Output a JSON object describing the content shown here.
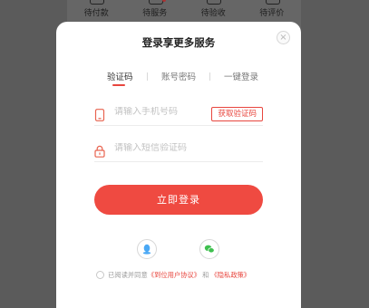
{
  "background": {
    "tabs": [
      {
        "label": "待付款",
        "icon": "wallet-icon",
        "badge": false
      },
      {
        "label": "待服务",
        "icon": "service-icon",
        "badge": true
      },
      {
        "label": "待验收",
        "icon": "inspect-icon",
        "badge": false
      },
      {
        "label": "待评价",
        "icon": "review-icon",
        "badge": false
      }
    ]
  },
  "modal": {
    "title": "登录享更多服务",
    "close_icon": "×",
    "tabs": [
      {
        "label": "验证码",
        "active": true
      },
      {
        "label": "账号密码",
        "active": false
      },
      {
        "label": "一键登录",
        "active": false
      }
    ],
    "phone": {
      "placeholder": "请输入手机号码",
      "value": "",
      "icon": "phone-icon"
    },
    "code_button": "获取验证码",
    "sms": {
      "placeholder": "请输入短信验证码",
      "value": "",
      "icon": "lock-icon"
    },
    "login_button": "立即登录",
    "social": [
      {
        "name": "qq",
        "icon": "qq-icon",
        "color": "#4aa8f5"
      },
      {
        "name": "wechat",
        "icon": "wechat-icon",
        "color": "#3fc04f"
      }
    ],
    "agreement": {
      "prefix": "已阅读并同意",
      "user_agreement": "《到位用户协议》",
      "and": "和",
      "privacy_policy": "《隐私政策》"
    }
  },
  "colors": {
    "accent": "#ef4a41",
    "overlay": "#5b5b5b"
  }
}
